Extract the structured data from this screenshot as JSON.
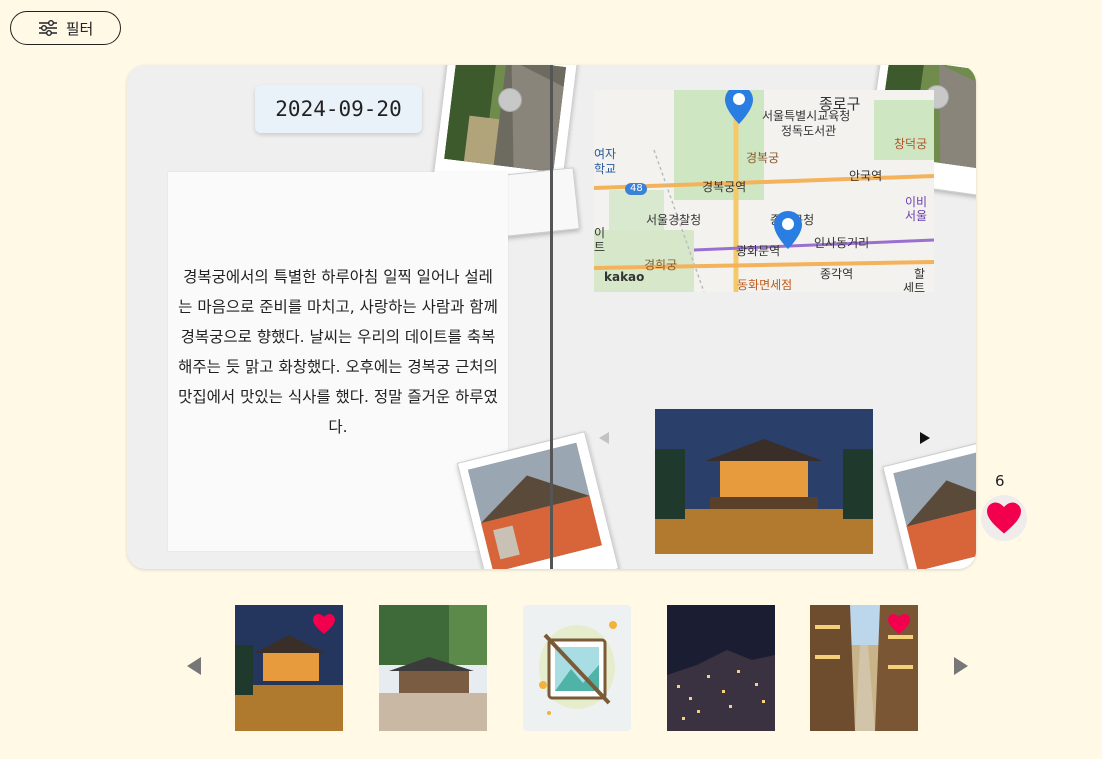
{
  "toolbar": {
    "filter_label": "필터",
    "filter_icon": "sliders-icon"
  },
  "diary": {
    "date": "2024-09-20",
    "body": "경복궁에서의 특별한 하루아침 일찍 일어나 설레는 마음으로 준비를 마치고, 사랑하는 사람과 함께 경복궁으로 향했다. 날씨는 우리의 데이트를 축복해주는 듯 맑고 화창했다. 오후에는 경복궁 근처의 맛집에서 맛있는 식사를 했다. 정말 즐거운 하루였다."
  },
  "map": {
    "provider": "kakao",
    "labels": {
      "jongno": "종로구",
      "office": "서울특별시교육청",
      "library": "정독도서관",
      "palace": "경복궁",
      "gbg_station": "경복궁역",
      "anguk": "안국역",
      "changdeok": "창덕궁",
      "police": "서울경찰청",
      "gu_office": "종로구청",
      "insadong": "인사동거리",
      "gwanghwamun": "광화문역",
      "gyeonghui": "경희궁",
      "jonggak": "종각역",
      "dutyfree": "동화면세점",
      "women_univ": "여자",
      "school": "학교",
      "ibis1": "이비",
      "ibis2": "서울",
      "route": "48",
      "edge": "세트",
      "edge2": "할",
      "edge3": "이",
      "edge4": "트"
    }
  },
  "likes": {
    "count": "6"
  },
  "colors": {
    "background": "#fff9e6",
    "heart": "#f2004d",
    "book": "#efefef"
  },
  "gallery": {
    "thumbnails": [
      {
        "name": "palace-night",
        "liked": true
      },
      {
        "name": "temple-day",
        "liked": false
      },
      {
        "name": "no-image",
        "liked": false
      },
      {
        "name": "city-night",
        "liked": false
      },
      {
        "name": "arcade-street",
        "liked": true
      }
    ]
  }
}
